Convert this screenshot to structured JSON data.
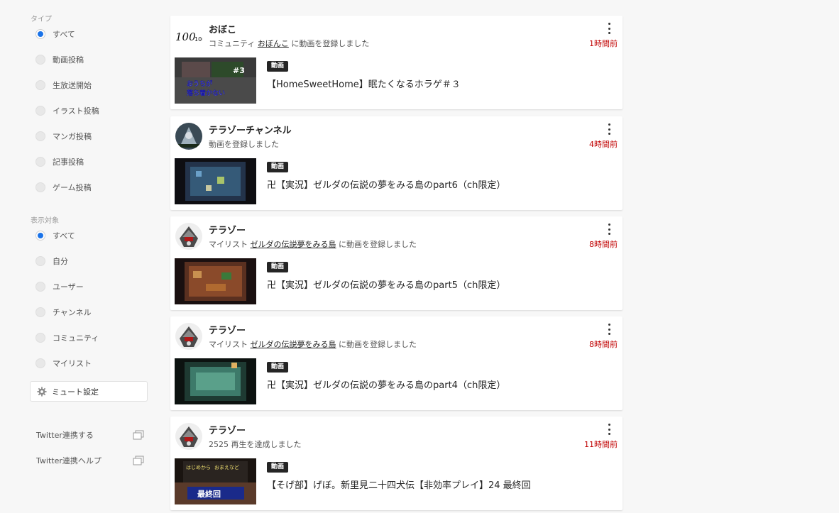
{
  "sidebar": {
    "type_label": "タイプ",
    "type_options": [
      "すべて",
      "動画投稿",
      "生放送開始",
      "イラスト投稿",
      "マンガ投稿",
      "記事投稿",
      "ゲーム投稿"
    ],
    "target_label": "表示対象",
    "target_options": [
      "すべて",
      "自分",
      "ユーザー",
      "チャンネル",
      "コミュニティ",
      "マイリスト"
    ],
    "mute_label": "ミュート設定",
    "twitter_link": "Twitter連携する",
    "twitter_help": "Twitter連携ヘルプ"
  },
  "feed": [
    {
      "author": "おぼこ",
      "sub_prefix": "コミュニティ",
      "sub_link": "おぼんこ",
      "sub_suffix": "に動画を登録しました",
      "time": "1時間前",
      "badge": "動画",
      "title": "【HomeSweetHome】眠たくなるホラゲ＃３",
      "thumb_text": [
        "おうちが",
        "落ち着かない",
        "#3"
      ]
    },
    {
      "author": "テラゾーチャンネル",
      "sub_prefix": "",
      "sub_link": "",
      "sub_suffix": "動画を登録しました",
      "time": "4時間前",
      "badge": "動画",
      "title": "卍【実況】ゼルダの伝説の夢をみる島のpart6（ch限定）",
      "thumb_text": []
    },
    {
      "author": "テラゾー",
      "sub_prefix": "マイリスト",
      "sub_link": "ゼルダの伝説夢をみる島",
      "sub_suffix": "に動画を登録しました",
      "time": "8時間前",
      "badge": "動画",
      "title": "卍【実況】ゼルダの伝説の夢をみる島のpart5（ch限定）",
      "thumb_text": []
    },
    {
      "author": "テラゾー",
      "sub_prefix": "マイリスト",
      "sub_link": "ゼルダの伝説夢をみる島",
      "sub_suffix": "に動画を登録しました",
      "time": "8時間前",
      "badge": "動画",
      "title": "卍【実況】ゼルダの伝説の夢をみる島のpart4（ch限定）",
      "thumb_text": []
    },
    {
      "author": "テラゾー",
      "sub_prefix": "",
      "sub_link": "",
      "sub_suffix": "2525 再生を達成しました",
      "time": "11時間前",
      "badge": "動画",
      "title": "【そげ部】げぼ。新里見二十四犬伝【非効率プレイ】24 最終回",
      "thumb_text": [
        "はじめから",
        "おまえなど",
        "最終回"
      ]
    }
  ],
  "colors": {
    "accent": "#1a73e8",
    "time": "#c00000",
    "badge_bg": "#252525"
  },
  "logo_text": "100円"
}
